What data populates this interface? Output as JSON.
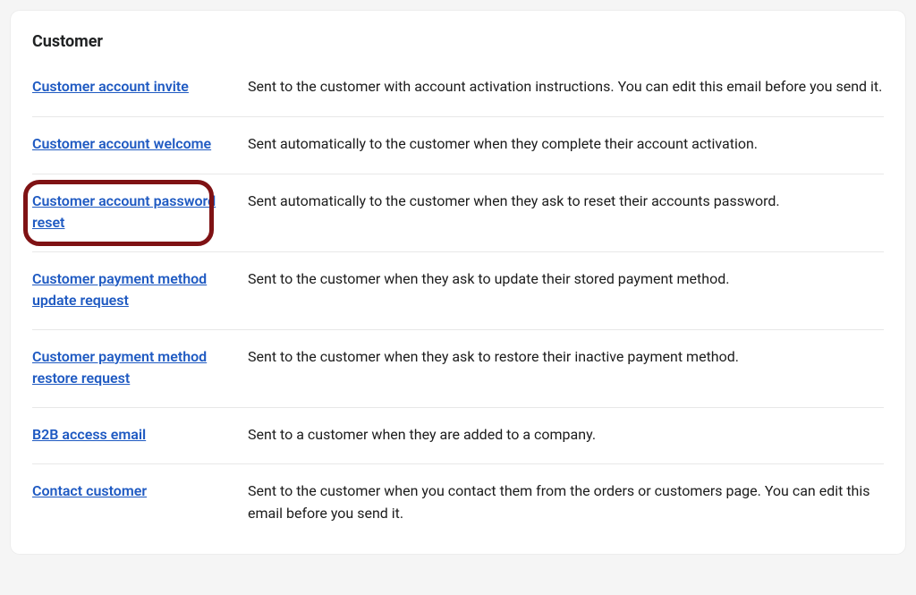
{
  "section_title": "Customer",
  "rows": [
    {
      "link": "Customer account invite",
      "desc": "Sent to the customer with account activation instructions. You can edit this email before you send it."
    },
    {
      "link": "Customer account welcome",
      "desc": "Sent automatically to the customer when they complete their account activation."
    },
    {
      "link": "Customer account password reset",
      "desc": "Sent automatically to the customer when they ask to reset their accounts password."
    },
    {
      "link": "Customer payment method update request",
      "desc": "Sent to the customer when they ask to update their stored payment method."
    },
    {
      "link": "Customer payment method restore request",
      "desc": "Sent to the customer when they ask to restore their inactive payment method."
    },
    {
      "link": "B2B access email",
      "desc": "Sent to a customer when they are added to a company."
    },
    {
      "link": "Contact customer",
      "desc": "Sent to the customer when you contact them from the orders or customers page. You can edit this email before you send it."
    }
  ]
}
